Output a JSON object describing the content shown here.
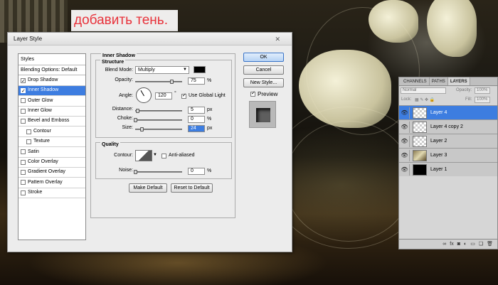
{
  "caption": "добавить тень.",
  "dialog": {
    "title": "Layer Style",
    "close_glyph": "✕",
    "styles_header": "Styles",
    "styles": [
      {
        "label": "Blending Options: Default",
        "checkbox": false,
        "checked": false,
        "selected": false
      },
      {
        "label": "Drop Shadow",
        "checkbox": true,
        "checked": true,
        "selected": false
      },
      {
        "label": "Inner Shadow",
        "checkbox": true,
        "checked": true,
        "selected": true
      },
      {
        "label": "Outer Glow",
        "checkbox": true,
        "checked": false,
        "selected": false
      },
      {
        "label": "Inner Glow",
        "checkbox": true,
        "checked": false,
        "selected": false
      },
      {
        "label": "Bevel and Emboss",
        "checkbox": true,
        "checked": false,
        "selected": false
      },
      {
        "label": "Contour",
        "checkbox": true,
        "checked": false,
        "selected": false,
        "sub": true
      },
      {
        "label": "Texture",
        "checkbox": true,
        "checked": false,
        "selected": false,
        "sub": true
      },
      {
        "label": "Satin",
        "checkbox": true,
        "checked": false,
        "selected": false
      },
      {
        "label": "Color Overlay",
        "checkbox": true,
        "checked": false,
        "selected": false
      },
      {
        "label": "Gradient Overlay",
        "checkbox": true,
        "checked": false,
        "selected": false
      },
      {
        "label": "Pattern Overlay",
        "checkbox": true,
        "checked": false,
        "selected": false
      },
      {
        "label": "Stroke",
        "checkbox": true,
        "checked": false,
        "selected": false
      }
    ],
    "section_title": "Inner Shadow",
    "structure": {
      "title": "Structure",
      "blend_mode_label": "Blend Mode:",
      "blend_mode": "Multiply",
      "shadow_color": "#000000",
      "opacity_label": "Opacity:",
      "opacity": "75",
      "opacity_unit": "%",
      "angle_label": "Angle:",
      "angle": "120",
      "angle_unit": "°",
      "use_global_light": "Use Global Light",
      "distance_label": "Distance:",
      "distance": "5",
      "choke_label": "Choke:",
      "choke": "0",
      "size_label": "Size:",
      "size": "24",
      "px": "px",
      "pct": "%"
    },
    "quality": {
      "title": "Quality",
      "contour_label": "Contour:",
      "anti_aliased": "Anti-aliased",
      "noise_label": "Noise:",
      "noise": "0",
      "noise_unit": "%"
    },
    "make_default": "Make Default",
    "reset_to_default": "Reset to Default",
    "ok": "OK",
    "cancel": "Cancel",
    "new_style": "New Style...",
    "preview": "Preview"
  },
  "layers_panel": {
    "tabs": [
      "CHANNELS",
      "PATHS",
      "LAYERS"
    ],
    "blend_mode": "Normal",
    "opacity_label": "Opacity:",
    "opacity": "100%",
    "lock_label": "Lock:",
    "fill_label": "Fill:",
    "fill": "100%",
    "layers": [
      {
        "name": "Layer 4",
        "selected": true,
        "thumb": "transparent"
      },
      {
        "name": "Layer 4 copy 2",
        "selected": false,
        "thumb": "transparent"
      },
      {
        "name": "Layer 2",
        "selected": false,
        "thumb": "transparent"
      },
      {
        "name": "Layer 3",
        "selected": false,
        "thumb": "image"
      },
      {
        "name": "Layer 1",
        "selected": false,
        "thumb": "black"
      }
    ],
    "footer_icons": [
      "link-icon",
      "fx-icon",
      "mask-icon",
      "adjustment-icon",
      "folder-icon",
      "new-layer-icon",
      "trash-icon"
    ]
  }
}
